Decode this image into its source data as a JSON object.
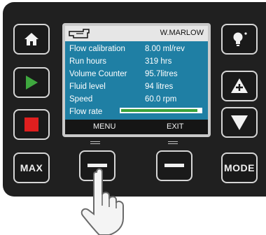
{
  "screen": {
    "user": "W.MARLOW",
    "rows": [
      {
        "label": "Flow calibration",
        "value": "8.00 ml/rev"
      },
      {
        "label": "Run hours",
        "value": "319   hrs"
      },
      {
        "label": "Volume Counter",
        "value": "95.7litres"
      },
      {
        "label": "Fluid level",
        "value": "94  litres"
      },
      {
        "label": "Speed",
        "value": "60.0 rpm"
      }
    ],
    "flow_rate_label": "Flow rate",
    "flow_rate_level": 0.96,
    "softkey_left": "MENU",
    "softkey_right": "EXIT"
  },
  "buttons": {
    "max": "MAX",
    "mode": "MODE"
  },
  "icons": {
    "home": "home-icon",
    "run": "play-icon",
    "stop": "stop-icon",
    "info": "lightbulb-icon",
    "up": "up-arrow-icon",
    "down": "down-arrow-icon",
    "hand": "hand-pointer-icon"
  },
  "colors": {
    "run": "#3fa83f",
    "stop": "#e01f1f",
    "screen_bg": "#1f7fa4",
    "flow_fill": "#3aa23a"
  }
}
